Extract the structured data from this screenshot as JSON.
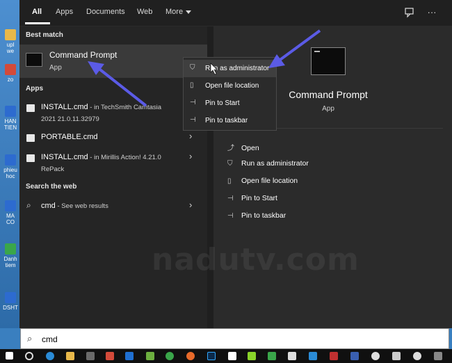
{
  "desktop": {
    "icons": [
      {
        "label": "upl\nwe",
        "color": "#e8b84a"
      },
      {
        "label": "zo",
        "color": "#d34a3a"
      },
      {
        "label": "HAN\nTIEN",
        "color": "#2d6bcf"
      },
      {
        "label": "phieu\nhoc",
        "color": "#2d6bcf"
      },
      {
        "label": "MA\nCO",
        "color": "#2d6bcf"
      },
      {
        "label": "Danh\ntiem",
        "color": "#3aa64a"
      },
      {
        "label": "DSHT",
        "color": "#2d6bcf"
      }
    ]
  },
  "tabs": [
    {
      "label": "All",
      "active": true
    },
    {
      "label": "Apps"
    },
    {
      "label": "Documents"
    },
    {
      "label": "Web"
    },
    {
      "label": "More"
    }
  ],
  "top_icons": {
    "feedback": "feedback-icon",
    "more": "more-options-icon",
    "more_glyph": "···"
  },
  "sections": {
    "best_match": "Best match",
    "apps": "Apps",
    "search_web": "Search the web"
  },
  "best_match": {
    "title": "Command Prompt",
    "subtitle": "App"
  },
  "apps": [
    {
      "title": "INSTALL.cmd",
      "meta": " - in TechSmith Camtasia",
      "line2": "2021 21.0.11.32979"
    },
    {
      "title": "PORTABLE.cmd",
      "meta": "",
      "line2": ""
    },
    {
      "title": "INSTALL.cmd",
      "meta": " - in Mirillis Action! 4.21.0",
      "line2": "RePack"
    }
  ],
  "web_search": {
    "query": "cmd",
    "suffix": " - See web results"
  },
  "details": {
    "title": "Command Prompt",
    "subtitle": "App",
    "actions": [
      {
        "label": "Open",
        "icon": "open-icon"
      },
      {
        "label": "Run as administrator",
        "icon": "shield-icon"
      },
      {
        "label": "Open file location",
        "icon": "file-icon"
      },
      {
        "label": "Pin to Start",
        "icon": "pin-icon"
      },
      {
        "label": "Pin to taskbar",
        "icon": "pin-icon"
      }
    ]
  },
  "context_menu": [
    {
      "label": "Run as administrator",
      "icon": "shield-icon",
      "highlighted": true
    },
    {
      "label": "Open file location",
      "icon": "file-icon"
    },
    {
      "label": "Pin to Start",
      "icon": "pin-icon"
    },
    {
      "label": "Pin to taskbar",
      "icon": "pin-icon"
    }
  ],
  "search_box": {
    "value": "cmd"
  },
  "watermark": "nadutv.com",
  "colors": {
    "accent": "#5b5be6",
    "menu_bg": "#1f1f1f",
    "highlight": "#3a3a3a"
  }
}
